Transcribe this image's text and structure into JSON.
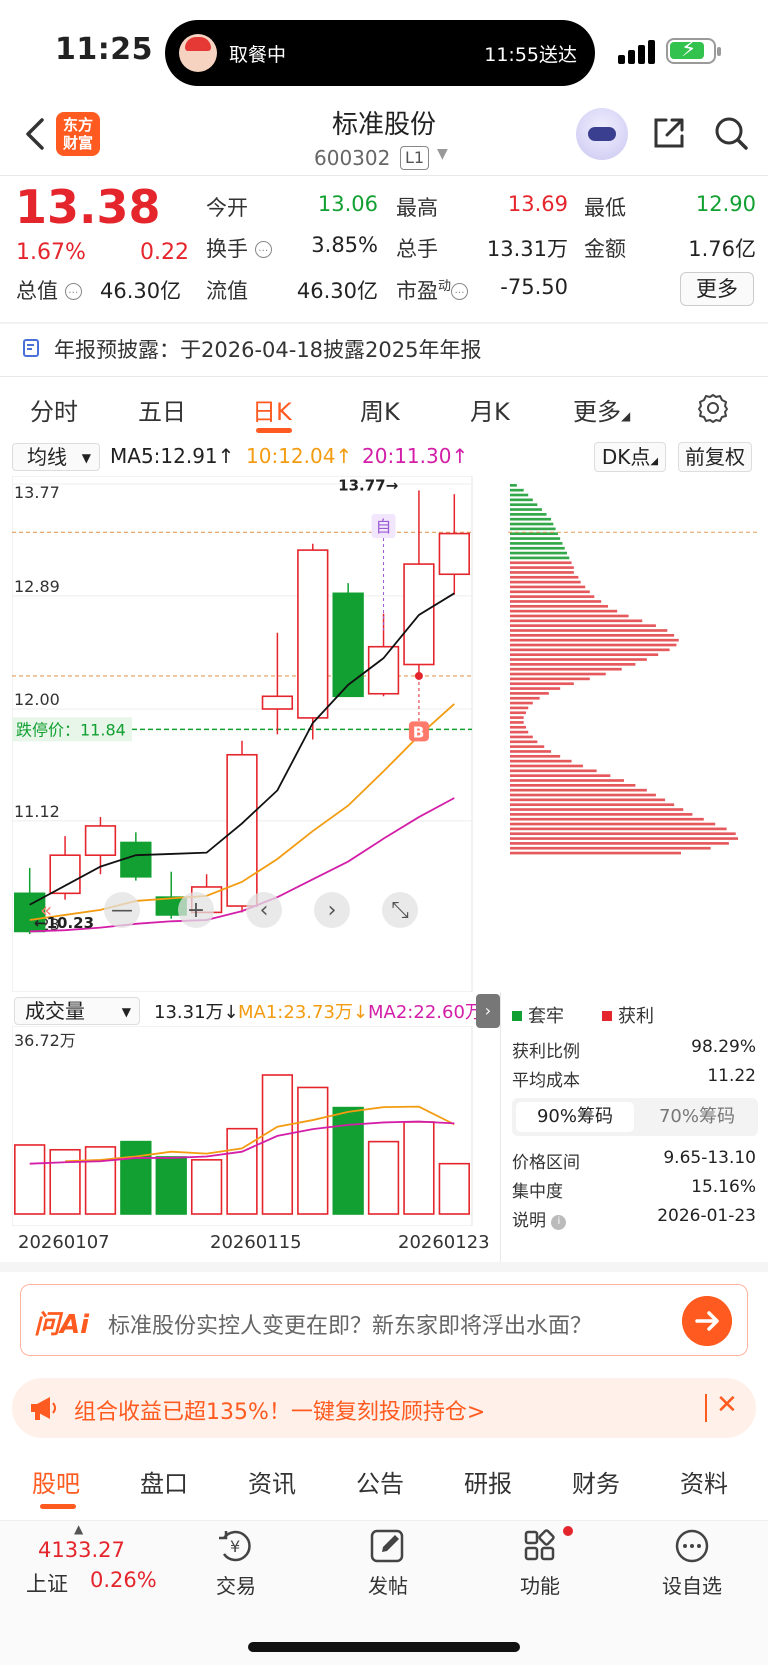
{
  "status": {
    "time": "11:25",
    "activity": "取餐中",
    "eta": "11:55送达"
  },
  "header": {
    "logo_line1": "东方",
    "logo_line2": "财富",
    "name": "标准股份",
    "code": "600302",
    "level": "L1"
  },
  "quote": {
    "price": "13.38",
    "pct": "1.67%",
    "change": "0.22",
    "open_label": "今开",
    "open": "13.06",
    "high_label": "最高",
    "high": "13.69",
    "low_label": "最低",
    "low": "12.90",
    "turnover_label": "换手",
    "turnover": "3.85%",
    "volume_label": "总手",
    "volume": "13.31万",
    "amount_label": "金额",
    "amount": "1.76亿",
    "mktcap_label": "总值",
    "mktcap": "46.30亿",
    "float_label": "流值",
    "float": "46.30亿",
    "pe_label": "市盈",
    "pe_sup": "动",
    "pe": "-75.50",
    "more": "更多"
  },
  "notice": "年报预披露：于2026-04-18披露2025年年报",
  "tabs": [
    "分时",
    "五日",
    "日K",
    "周K",
    "月K",
    "更多"
  ],
  "ma_bar": {
    "select": "均线",
    "ma5": "MA5:12.91↑",
    "ma10": "10:12.04↑",
    "ma20": "20:11.30↑",
    "dk": "DK点",
    "fq": "前复权"
  },
  "vol_bar": {
    "select": "成交量",
    "vol": "13.31万↓",
    "ma1": "MA1:23.73万↓",
    "ma2": "MA2:22.60万"
  },
  "chart_data": {
    "type": "candlestick",
    "y_ticks": [
      "13.77",
      "12.89",
      "12.00",
      "11.12",
      "10.23"
    ],
    "ylim": [
      10.23,
      13.77
    ],
    "limit_down_label": "跌停价：11.84",
    "limit_down": 11.84,
    "ref_line": 12.26,
    "high_marker": "13.77→",
    "low_marker": "10.23",
    "cost_line": 13.39,
    "marker_self": "自",
    "marker_buy": "B",
    "candles": [
      {
        "o": 10.55,
        "h": 10.75,
        "l": 10.23,
        "c": 10.25,
        "up": false
      },
      {
        "o": 10.55,
        "h": 11.0,
        "l": 10.5,
        "c": 10.85,
        "up": true
      },
      {
        "o": 10.85,
        "h": 11.15,
        "l": 10.7,
        "c": 11.08,
        "up": true
      },
      {
        "o": 10.95,
        "h": 11.03,
        "l": 10.65,
        "c": 10.68,
        "up": false
      },
      {
        "o": 10.52,
        "h": 10.72,
        "l": 10.35,
        "c": 10.38,
        "up": false
      },
      {
        "o": 10.4,
        "h": 10.7,
        "l": 10.4,
        "c": 10.6,
        "up": true
      },
      {
        "o": 10.45,
        "h": 11.75,
        "l": 10.4,
        "c": 11.64,
        "up": true
      },
      {
        "o": 12.0,
        "h": 12.6,
        "l": 11.8,
        "c": 12.1,
        "up": true
      },
      {
        "o": 11.93,
        "h": 13.3,
        "l": 11.76,
        "c": 13.25,
        "up": true
      },
      {
        "o": 12.91,
        "h": 12.99,
        "l": 12.13,
        "c": 12.1,
        "up": false
      },
      {
        "o": 12.12,
        "h": 12.75,
        "l": 12.1,
        "c": 12.49,
        "up": true
      },
      {
        "o": 12.35,
        "h": 13.72,
        "l": 12.28,
        "c": 13.14,
        "up": true
      },
      {
        "o": 13.06,
        "h": 13.69,
        "l": 12.9,
        "c": 13.38,
        "up": true
      }
    ],
    "ma5": [
      10.46,
      10.61,
      10.76,
      10.85,
      10.86,
      10.87,
      11.1,
      11.36,
      11.89,
      12.19,
      12.4,
      12.74,
      12.91
    ],
    "ma10": [
      10.34,
      10.38,
      10.42,
      10.49,
      10.51,
      10.53,
      10.64,
      10.82,
      11.04,
      11.24,
      11.51,
      11.79,
      12.04
    ],
    "ma20": [
      10.25,
      10.26,
      10.28,
      10.31,
      10.33,
      10.34,
      10.41,
      10.52,
      10.66,
      10.8,
      10.98,
      11.15,
      11.3
    ],
    "volume_ylim_label": "36.72万",
    "volume": [
      {
        "v": 14.4,
        "up": true
      },
      {
        "v": 13.4,
        "up": true
      },
      {
        "v": 14.0,
        "up": true
      },
      {
        "v": 15.1,
        "up": false
      },
      {
        "v": 11.9,
        "up": false
      },
      {
        "v": 11.3,
        "up": true
      },
      {
        "v": 17.8,
        "up": true
      },
      {
        "v": 29.0,
        "up": true
      },
      {
        "v": 26.4,
        "up": true
      },
      {
        "v": 22.2,
        "up": false
      },
      {
        "v": 15.1,
        "up": true
      },
      {
        "v": 19.2,
        "up": true
      },
      {
        "v": 10.5,
        "up": true
      }
    ],
    "vol_ma1": [
      null,
      11.0,
      11.3,
      12.0,
      13.0,
      12.6,
      13.7,
      18.2,
      19.6,
      21.3,
      22.3,
      22.4,
      18.7
    ],
    "vol_ma2": [
      10.5,
      10.8,
      11.0,
      11.7,
      11.7,
      12.0,
      13.0,
      16.3,
      17.7,
      18.6,
      19.1,
      19.3,
      18.9
    ],
    "volume_ylim": [
      0,
      36.72
    ],
    "x_ticks": [
      "20260107",
      "20260115",
      "20260123"
    ],
    "chips": {
      "profit": [
        0,
        0,
        0,
        0,
        0,
        0,
        0,
        0,
        0,
        0,
        0,
        0,
        0,
        0,
        0,
        0,
        0.27,
        0.28,
        0.28,
        0.3,
        0.31,
        0.33,
        0.35,
        0.37,
        0.4,
        0.43,
        0.47,
        0.52,
        0.58,
        0.64,
        0.69,
        0.72,
        0.74,
        0.73,
        0.7,
        0.65,
        0.6,
        0.55,
        0.49,
        0.42,
        0.35,
        0.28,
        0.22,
        0.17,
        0.13,
        0.1,
        0.08,
        0.07,
        0.06,
        0.06,
        0.07,
        0.08,
        0.1,
        0.12,
        0.15,
        0.18,
        0.22,
        0.27,
        0.32,
        0.38,
        0.44,
        0.5,
        0.55,
        0.6,
        0.64,
        0.68,
        0.72,
        0.76,
        0.8,
        0.85,
        0.9,
        0.95,
        0.99,
        1.0,
        0.96,
        0.88,
        0.75
      ],
      "trapped": [
        0.03,
        0.06,
        0.08,
        0.1,
        0.12,
        0.14,
        0.16,
        0.18,
        0.19,
        0.2,
        0.21,
        0.22,
        0.23,
        0.24,
        0.25,
        0.26
      ],
      "legend_trapped": "套牢",
      "legend_profit": "获利",
      "stats": [
        {
          "label": "获利比例",
          "value": "98.29%"
        },
        {
          "label": "平均成本",
          "value": "11.22"
        }
      ],
      "tab_90": "90%筹码",
      "tab_70": "70%筹码",
      "stats2": [
        {
          "label": "价格区间",
          "value": "9.65-13.10"
        },
        {
          "label": "集中度",
          "value": "15.16%"
        },
        {
          "label": "说明",
          "value": "2026-01-23"
        }
      ]
    }
  },
  "ai": {
    "logo": "问Ai",
    "text": "标准股份实控人变更在即？新东家即将浮出水面？"
  },
  "promo": {
    "text": "组合收益已超135%！一键复刻投顾持仓>"
  },
  "bottom_tabs": [
    "股吧",
    "盘口",
    "资讯",
    "公告",
    "研报",
    "财务",
    "资料"
  ],
  "index": {
    "value": "4133.27",
    "name": "上证",
    "pct": "0.26%"
  },
  "nav": [
    "交易",
    "发帖",
    "功能",
    "设自选"
  ],
  "colors": {
    "up": "#e5252c",
    "down": "#11a031",
    "accent": "#ff5a1f",
    "ma5": "#111111",
    "ma10": "#f39c12",
    "ma20": "#d31ea8"
  }
}
